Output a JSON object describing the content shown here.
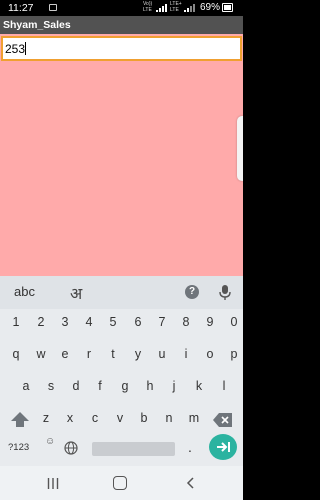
{
  "status_bar": {
    "time": "11:27",
    "network_line1": "Vo))",
    "network_line2": "LTE",
    "network2_line1": "LTE+",
    "network2_line2": "LTE",
    "battery_percent": "69%",
    "icons": [
      "notification-icon",
      "signal-icon",
      "signal-icon-2",
      "battery-icon"
    ]
  },
  "app": {
    "title": "Shyam_Sales",
    "background_color": "#ffaaaa",
    "input_value": "253",
    "input_border_color": "#f0a030"
  },
  "keyboard": {
    "top": {
      "mode_label": "abc",
      "hindi_label": "अ",
      "help_label": "?"
    },
    "row_numbers": [
      "1",
      "2",
      "3",
      "4",
      "5",
      "6",
      "7",
      "8",
      "9",
      "0"
    ],
    "row_1": [
      "q",
      "w",
      "e",
      "r",
      "t",
      "y",
      "u",
      "i",
      "o",
      "p"
    ],
    "row_2": [
      "a",
      "s",
      "d",
      "f",
      "g",
      "h",
      "j",
      "k",
      "l"
    ],
    "row_3": [
      "z",
      "x",
      "c",
      "v",
      "b",
      "n",
      "m"
    ],
    "bottom": {
      "symbols_label": "?123",
      "emoji_label": "☺",
      "period_label": ".",
      "enter_color": "#2bb3a0"
    }
  },
  "nav_bar": {
    "icons": [
      "recent-apps-icon",
      "home-icon",
      "back-icon"
    ]
  }
}
